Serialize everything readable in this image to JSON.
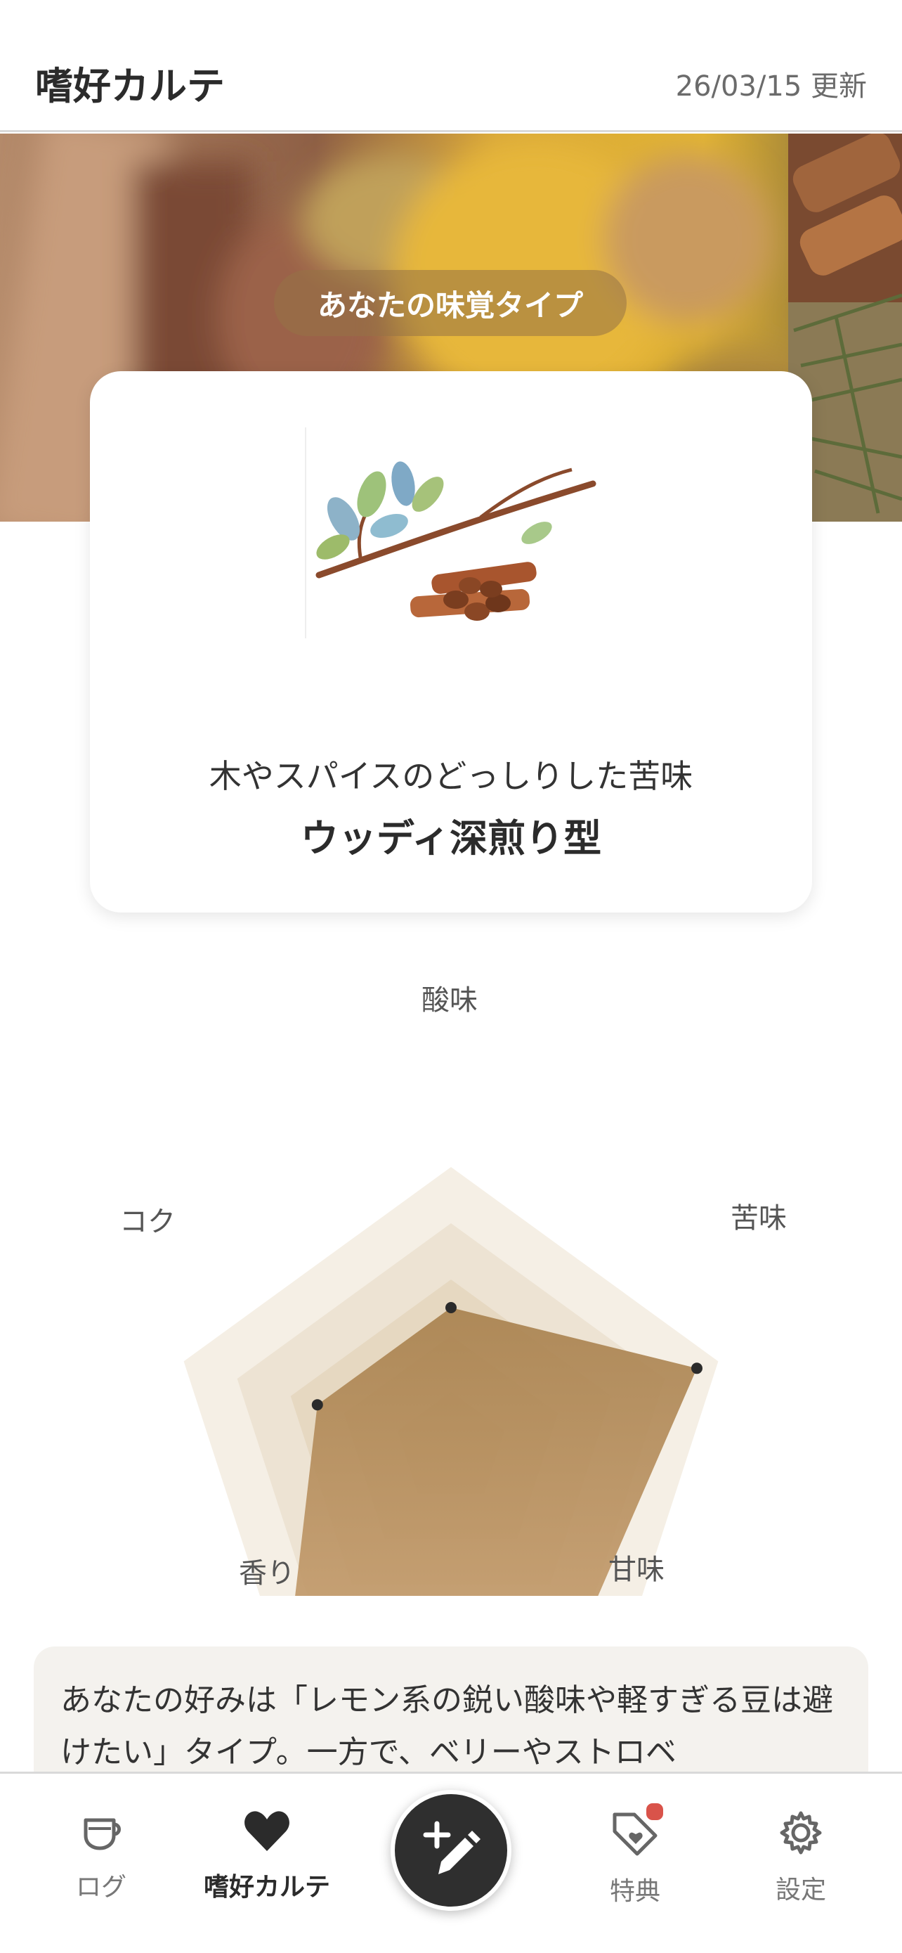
{
  "header": {
    "title": "嗜好カルテ",
    "updated": "26/03/15 更新"
  },
  "hero": {
    "pill_label": "あなたの味覚タイプ"
  },
  "type_card": {
    "subtitle": "木やスパイスのどっしりした苦味",
    "type_name": "ウッディ深煎り型"
  },
  "chart_data": {
    "type": "radar",
    "axes": [
      "酸味",
      "苦味",
      "甘味",
      "香り",
      "コク"
    ],
    "max": 5,
    "values": [
      2.5,
      4.6,
      4.0,
      5.0,
      2.5
    ]
  },
  "summary": {
    "text": "あなたの好みは「レモン系の鋭い酸味や軽すぎる豆は避けたい」タイプ。一方で、ベリーやストロベ"
  },
  "tabbar": {
    "items": [
      {
        "label": "ログ",
        "icon": "cup-icon"
      },
      {
        "label": "嗜好カルテ",
        "icon": "heart-icon"
      },
      {
        "label": "特典",
        "icon": "tag-heart-icon"
      },
      {
        "label": "設定",
        "icon": "gear-icon"
      }
    ],
    "active_index": 1,
    "fab_icon": "add-edit-icon"
  },
  "colors": {
    "accent": "#a9824f",
    "badge": "#d9534a",
    "fab": "#2f2f2f"
  }
}
